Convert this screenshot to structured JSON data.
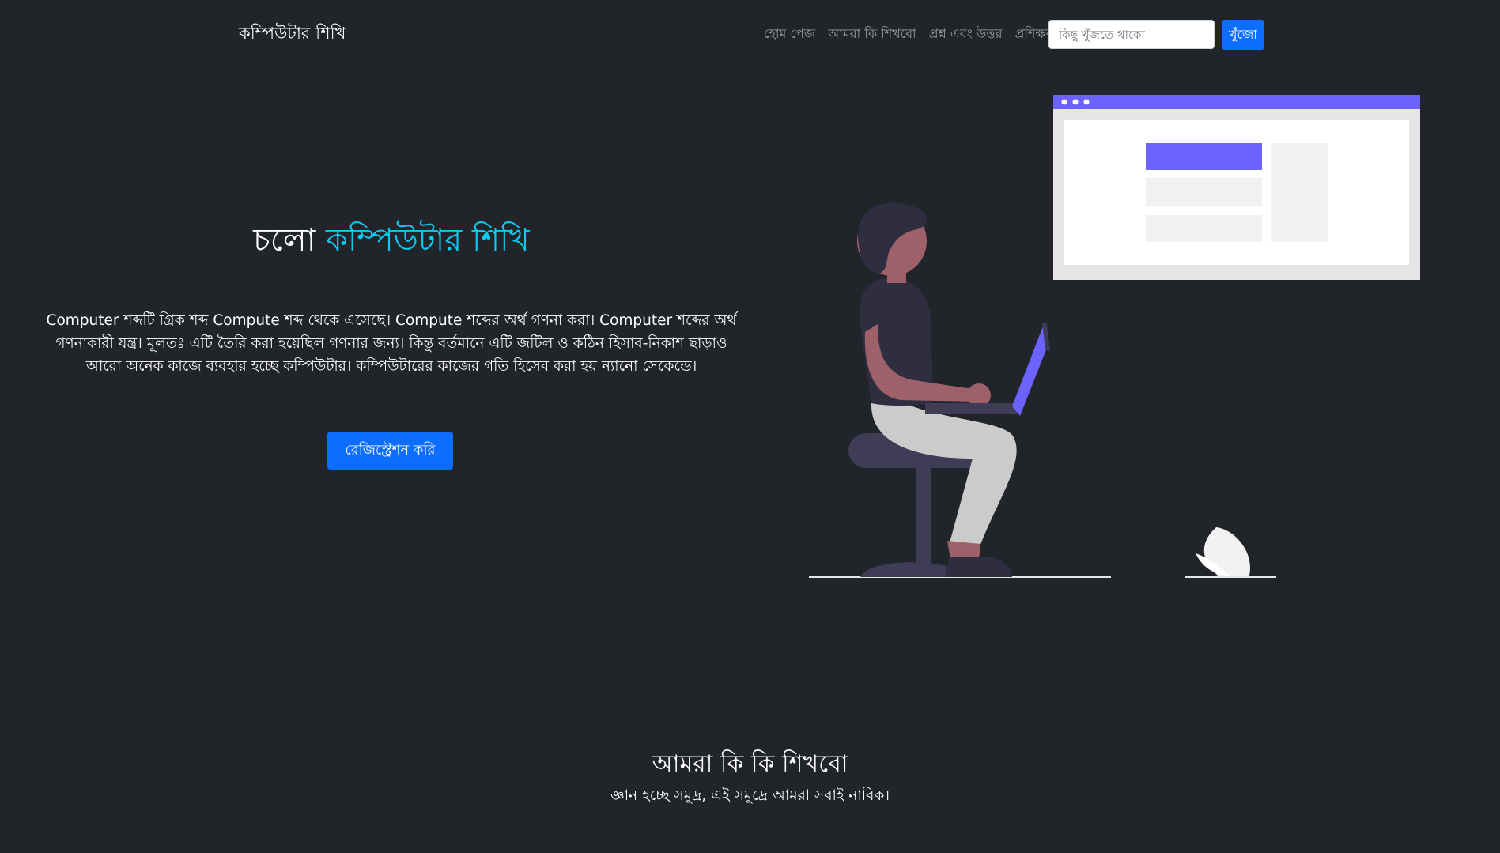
{
  "navbar": {
    "brand": "কম্পিউটার শিখি",
    "links": [
      "হোম পেজ",
      "আমরা কি শিখবো",
      "প্রশ্ন এবং উত্তর",
      "প্রশিক্ষক"
    ],
    "search_placeholder": "কিছু খুঁজতে থাকো",
    "search_button": "খুঁজো"
  },
  "hero": {
    "title_prefix": "চলো",
    "title_accent": "কম্পিউটার শিখি",
    "description": "Computer শব্দটি গ্রিক শব্দ Compute শব্দ থেকে এসেছে। Compute শব্দের অর্থ গণনা করা। Computer শব্দের অর্থ গণনাকারী যন্ত্র। মূলতঃ এটি তৈরি করা হয়েছিল গণনার জন্য। কিন্তু বর্তমানে এটি জটিল ও কঠিন হিসাব-নিকাশ ছাড়াও আরো অনেক কাজে ব্যবহার হচ্ছে কম্পিউটার। কম্পিউটারের কাজের গতি হিসেব করা হয় ন্যানো সেকেন্ডে।",
    "register_button": "রেজিস্ট্রেশন করি"
  },
  "section": {
    "title": "আমরা কি কি শিখবো",
    "subtitle": "জ্ঞান হচ্ছে সমুদ্র, এই সমুদ্রে আমরা সবাই নাবিক।"
  },
  "colors": {
    "background": "#212529",
    "accent": "#0dcaf0",
    "primary_button": "#0d6efd",
    "illustration_purple": "#6c63ff"
  }
}
